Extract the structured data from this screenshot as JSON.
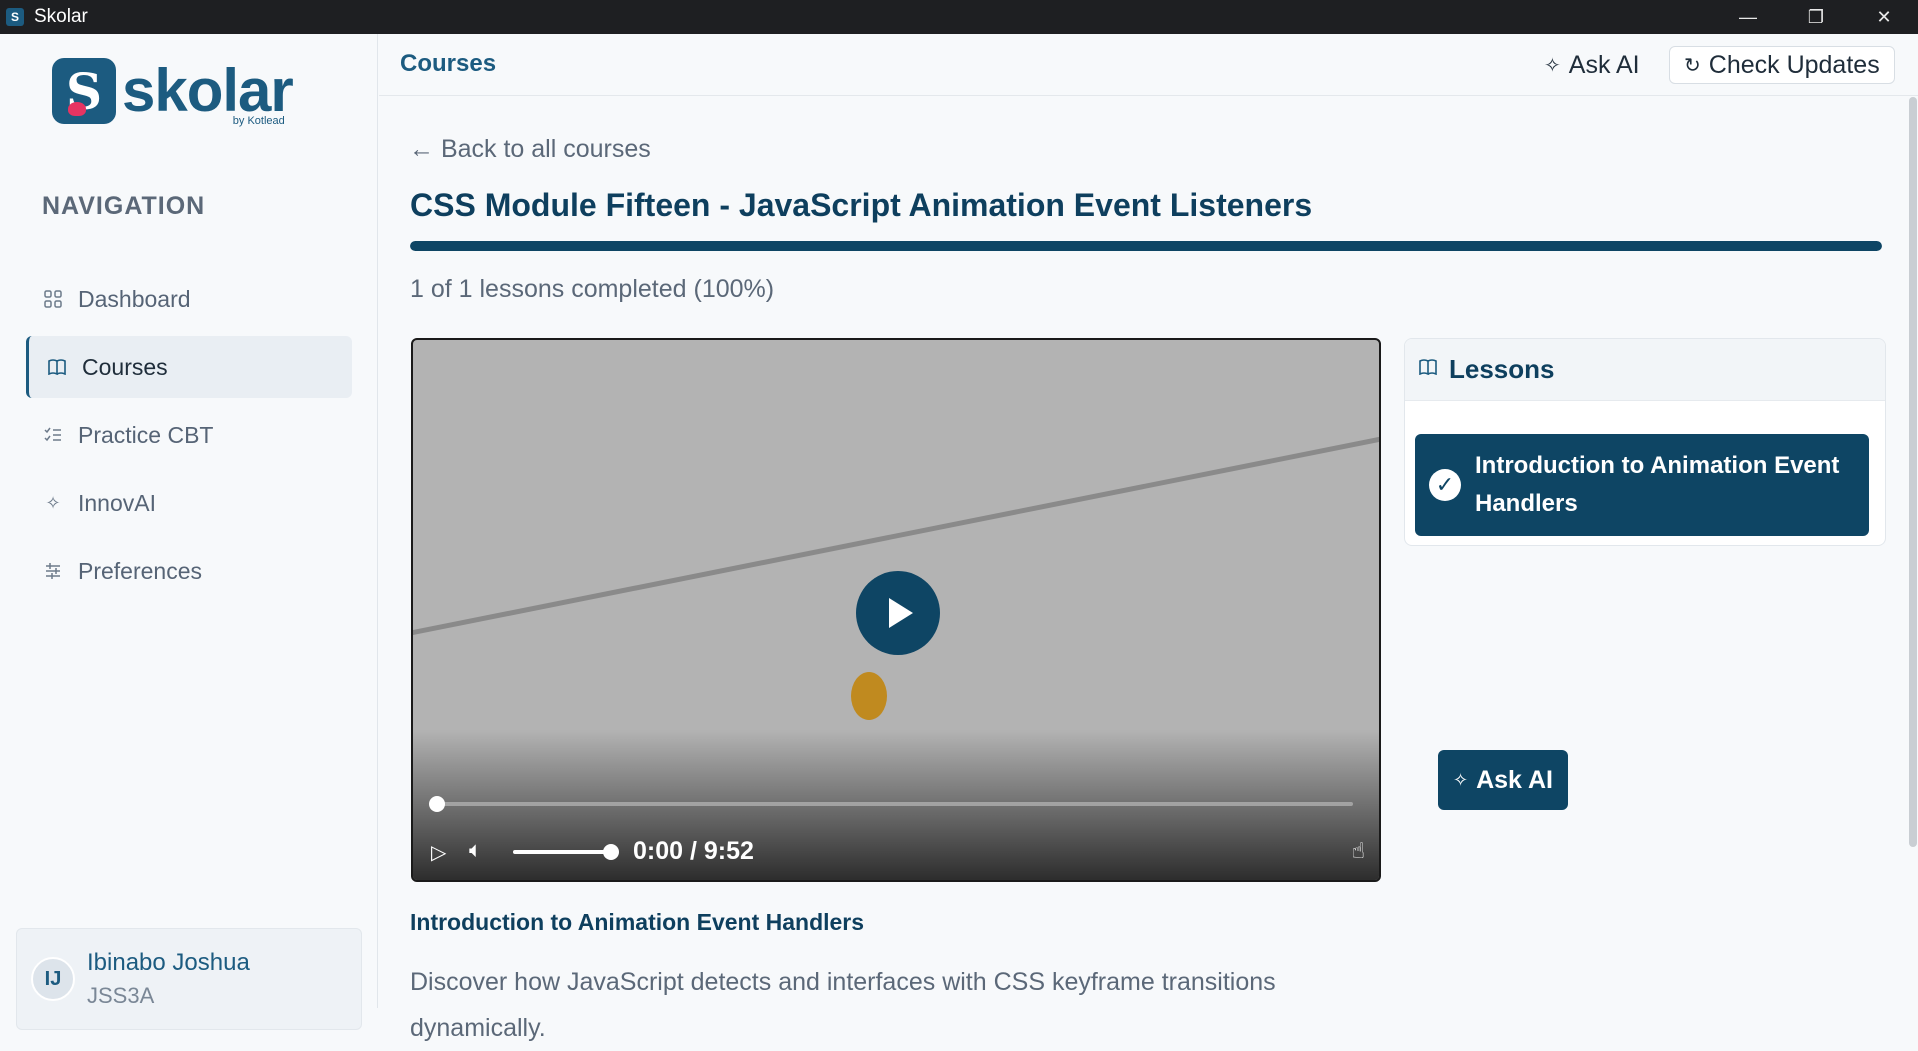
{
  "window": {
    "title": "Skolar",
    "minimize": "—",
    "restore": "❐",
    "close": "✕"
  },
  "brand": {
    "name": "skolar",
    "byline": "by Kotlead"
  },
  "sidebar": {
    "heading": "NAVIGATION",
    "items": [
      {
        "label": "Dashboard",
        "icon": "grid-icon"
      },
      {
        "label": "Courses",
        "icon": "book-icon",
        "active": true
      },
      {
        "label": "Practice CBT",
        "icon": "checklist-icon"
      },
      {
        "label": "InnovAI",
        "icon": "sparkle-icon"
      },
      {
        "label": "Preferences",
        "icon": "sliders-icon"
      }
    ]
  },
  "user": {
    "initials": "IJ",
    "name": "Ibinabo Joshua",
    "class": "JSS3A"
  },
  "header": {
    "title": "Courses",
    "ask_ai": "Ask AI",
    "check_updates": "Check Updates"
  },
  "course": {
    "back": "← Back to all courses",
    "title": "CSS Module Fifteen - JavaScript Animation Event Listeners",
    "progress_percent": 100,
    "progress_text": "1 of 1 lessons completed (100%)"
  },
  "video": {
    "time": "0:00 / 9:52",
    "position_fraction": 0,
    "volume_fraction": 1
  },
  "lessons": {
    "heading": "Lessons",
    "items": [
      {
        "label": "Introduction to Animation Event Handlers",
        "completed": true
      }
    ]
  },
  "lesson": {
    "title": "Introduction to Animation Event Handlers",
    "description": "Discover how JavaScript detects and interfaces with CSS keyframe transitions dynamically."
  },
  "fab": {
    "label": "Ask AI"
  },
  "colors": {
    "primary": "#0e4564",
    "brand": "#1c5b80",
    "accent": "#e63462"
  }
}
